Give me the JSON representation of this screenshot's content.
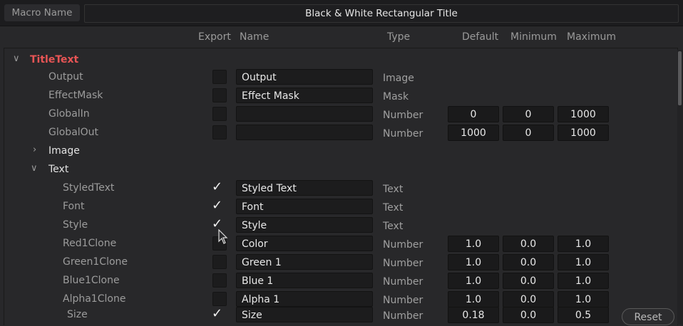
{
  "topbar": {
    "macro_name_label": "Macro Name",
    "macro_name_value": "Black & White Rectangular Title"
  },
  "headers": {
    "export": "Export",
    "name": "Name",
    "type": "Type",
    "default": "Default",
    "minimum": "Minimum",
    "maximum": "Maximum"
  },
  "tree": {
    "group_title": "TitleText",
    "group_image": "Image",
    "group_text": "Text"
  },
  "rows": [
    {
      "label": "Output",
      "checked": false,
      "name": "Output",
      "type": "Image"
    },
    {
      "label": "EffectMask",
      "checked": false,
      "name": "Effect Mask",
      "type": "Mask"
    },
    {
      "label": "GlobalIn",
      "checked": false,
      "name": "",
      "type": "Number",
      "default": "0",
      "min": "0",
      "max": "1000"
    },
    {
      "label": "GlobalOut",
      "checked": false,
      "name": "",
      "type": "Number",
      "default": "1000",
      "min": "0",
      "max": "1000"
    },
    {
      "label": "StyledText",
      "checked": true,
      "name": "Styled Text",
      "type": "Text"
    },
    {
      "label": "Font",
      "checked": true,
      "name": "Font",
      "type": "Text"
    },
    {
      "label": "Style",
      "checked": true,
      "name": "Style",
      "type": "Text"
    },
    {
      "label": "Red1Clone",
      "checked": false,
      "name": "Color",
      "type": "Number",
      "default": "1.0",
      "min": "0.0",
      "max": "1.0"
    },
    {
      "label": "Green1Clone",
      "checked": false,
      "name": "Green 1",
      "type": "Number",
      "default": "1.0",
      "min": "0.0",
      "max": "1.0"
    },
    {
      "label": "Blue1Clone",
      "checked": false,
      "name": "Blue 1",
      "type": "Number",
      "default": "1.0",
      "min": "0.0",
      "max": "1.0"
    },
    {
      "label": "Alpha1Clone",
      "checked": false,
      "name": "Alpha 1",
      "type": "Number",
      "default": "1.0",
      "min": "0.0",
      "max": "1.0"
    },
    {
      "label": "Size",
      "checked": true,
      "name": "Size",
      "type": "Number",
      "default": "0.18",
      "min": "0.0",
      "max": "0.5"
    }
  ],
  "buttons": {
    "reset": "Reset"
  },
  "icons": {
    "expanded": "chevron-down-icon",
    "collapsed": "chevron-right-icon",
    "check": "checkmark-icon",
    "cursor": "pointer-cursor-icon"
  },
  "colors": {
    "group_red": "#e85555",
    "background": "#28282a",
    "field": "#1c1c1d"
  }
}
